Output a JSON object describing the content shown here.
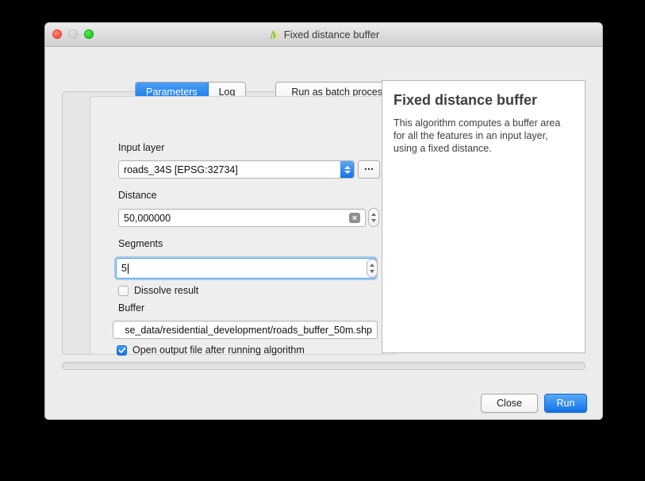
{
  "window": {
    "title": "Fixed distance buffer",
    "icon": "qgis-icon",
    "traffic_lights": {
      "close": "close-light",
      "minimize": "minimize-light",
      "zoom": "zoom-light"
    }
  },
  "tabs": [
    {
      "label": "Parameters",
      "active": true
    },
    {
      "label": "Log",
      "active": false
    }
  ],
  "toolbar": {
    "batch_label": "Run as batch process..."
  },
  "parameters": {
    "input_layer": {
      "label": "Input layer",
      "value": "roads_34S [EPSG:32734]",
      "browse_label": "...",
      "iterate_icon": "iterate-icon"
    },
    "distance": {
      "label": "Distance",
      "value": "50,000000",
      "browse_label": "...",
      "clear_icon": "clear-icon"
    },
    "segments": {
      "label": "Segments",
      "value": "5",
      "browse_label": "...",
      "focused": true
    },
    "dissolve": {
      "label": "Dissolve result",
      "checked": false
    },
    "buffer": {
      "label": "Buffer",
      "value": "se_data/residential_development/roads_buffer_50m.shp",
      "browse_label": "..."
    },
    "open_output": {
      "label": "Open output file after running algorithm",
      "checked": true
    }
  },
  "help": {
    "title": "Fixed distance buffer",
    "description": "This algorithm computes a buffer area for all the features in an input layer, using a fixed distance."
  },
  "progress": {
    "value": 0
  },
  "footer": {
    "close_label": "Close",
    "run_label": "Run"
  },
  "colors": {
    "accent_blue": "#1577e8",
    "window_bg": "#ececec",
    "panel_bg": "#eeeeee",
    "iterate_green": "#5cb85c"
  }
}
